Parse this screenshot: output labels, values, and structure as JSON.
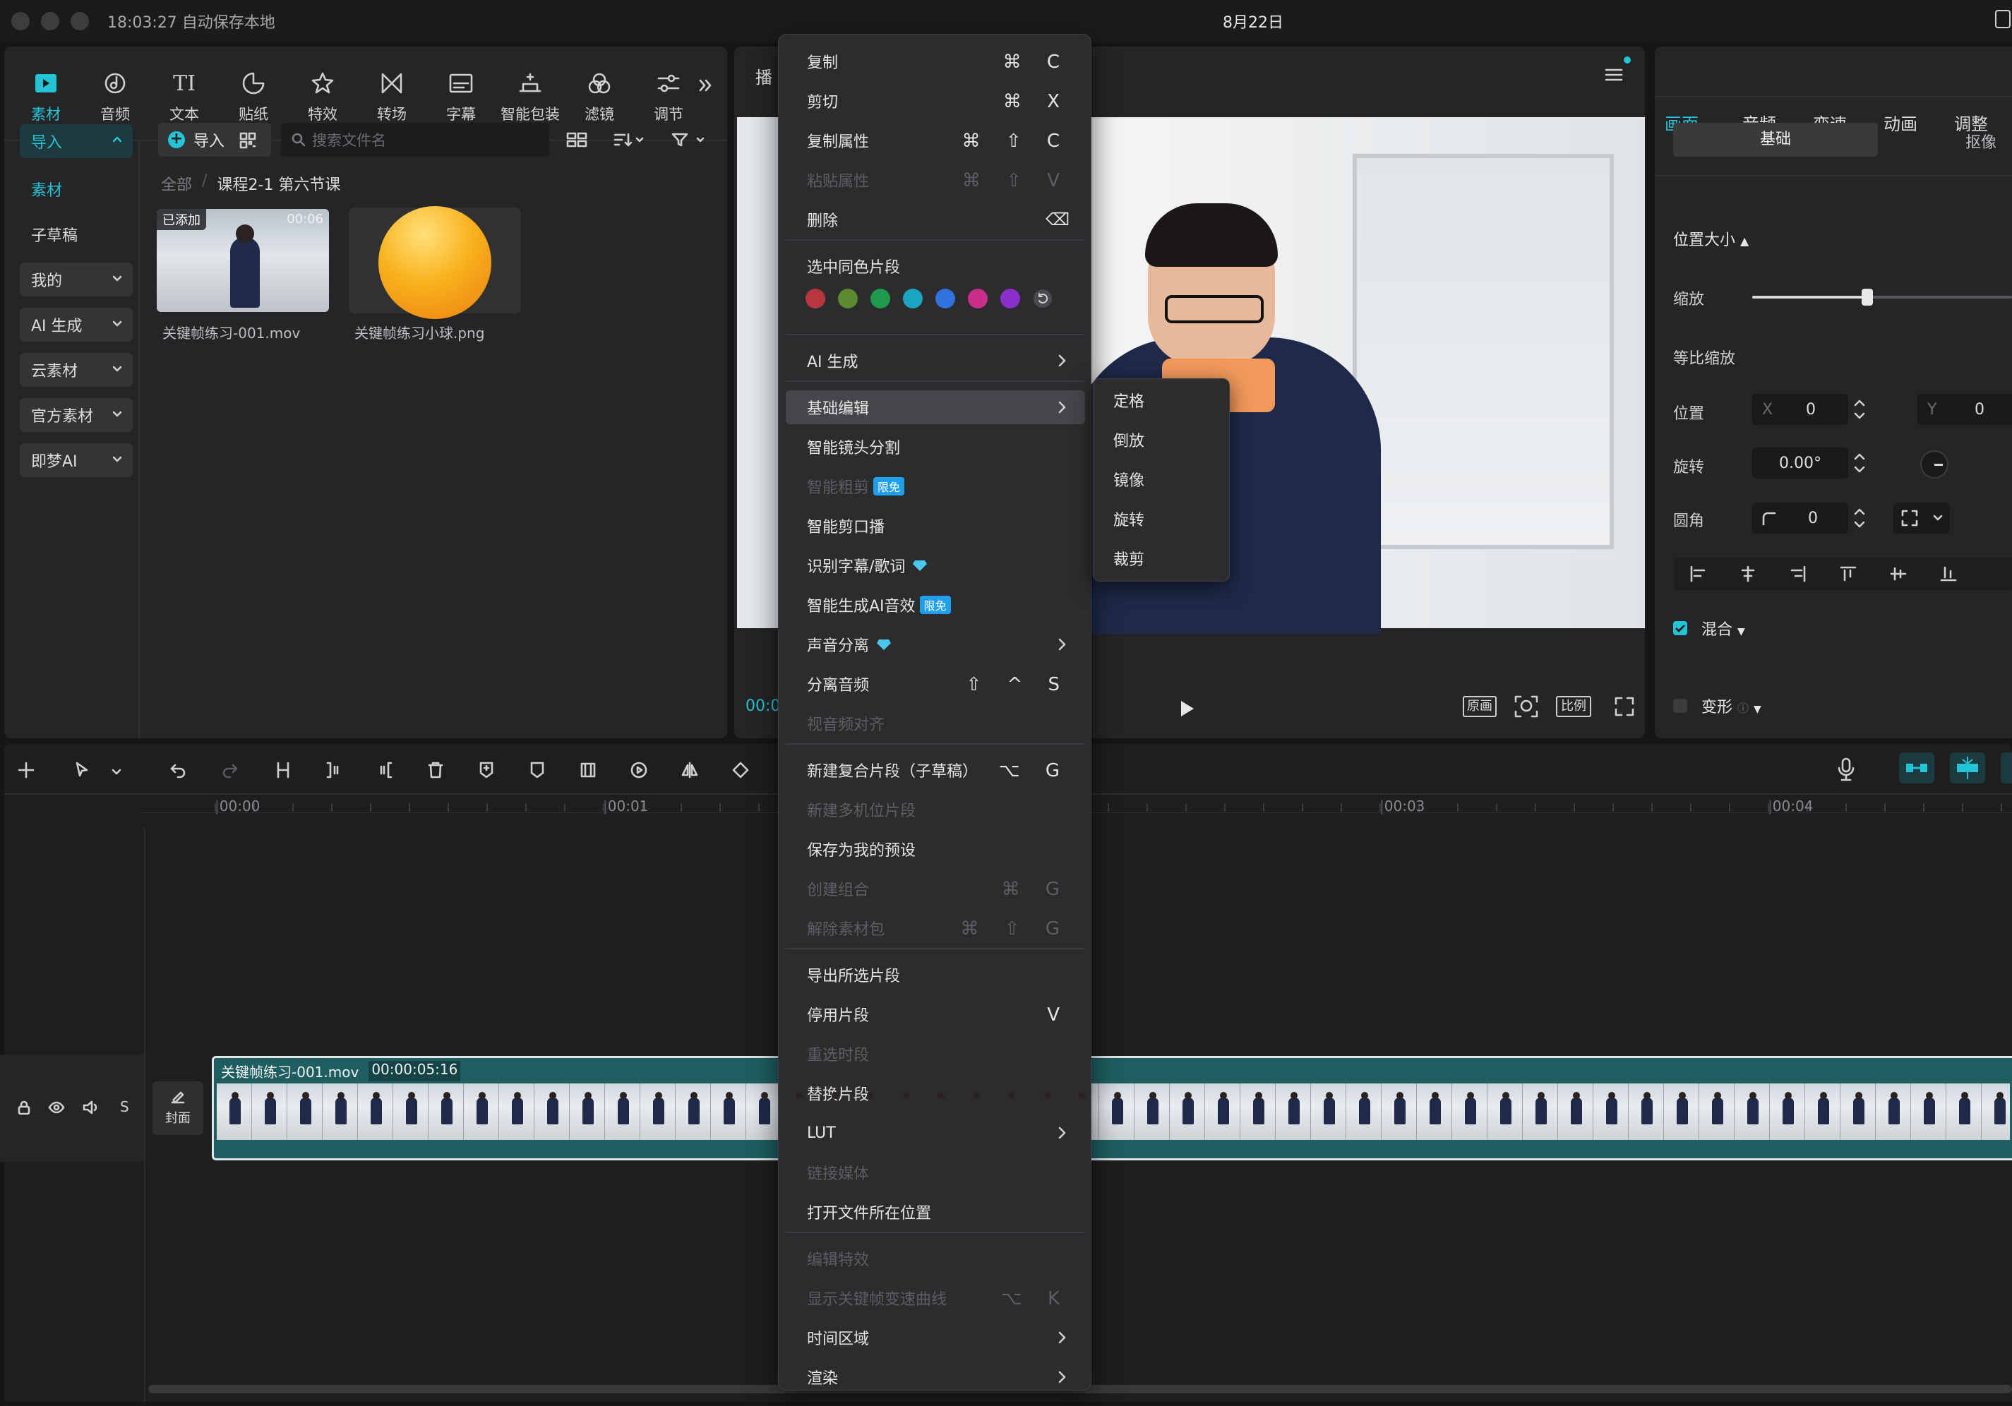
{
  "titlebar": {
    "autosave": "18:03:27 自动保存本地",
    "date": "8月22日"
  },
  "toolbar": {
    "tools": [
      {
        "label": "素材",
        "icon": "media-icon"
      },
      {
        "label": "音频",
        "icon": "audio-icon"
      },
      {
        "label": "文本",
        "icon": "text-icon",
        "glyph": "TI"
      },
      {
        "label": "贴纸",
        "icon": "sticker-icon"
      },
      {
        "label": "特效",
        "icon": "effects-icon"
      },
      {
        "label": "转场",
        "icon": "transition-icon"
      },
      {
        "label": "字幕",
        "icon": "subtitle-icon"
      },
      {
        "label": "智能包装",
        "icon": "smart-pack-icon"
      },
      {
        "label": "滤镜",
        "icon": "filter-icon"
      },
      {
        "label": "调节",
        "icon": "adjust-icon"
      }
    ]
  },
  "sidebar": {
    "items": [
      {
        "label": "导入",
        "state": "active"
      },
      {
        "label": "素材",
        "state": "selected"
      },
      {
        "label": "子草稿",
        "state": "plain"
      },
      {
        "label": "我的",
        "state": "expand"
      },
      {
        "label": "AI 生成",
        "state": "expand"
      },
      {
        "label": "云素材",
        "state": "expand"
      },
      {
        "label": "官方素材",
        "state": "expand"
      },
      {
        "label": "即梦AI",
        "state": "expand"
      }
    ]
  },
  "media": {
    "import_label": "导入",
    "search_placeholder": "搜索文件名",
    "breadcrumb_root": "全部",
    "breadcrumb_sep": "/",
    "breadcrumb_current": "课程2-1 第六节课",
    "files": [
      {
        "name": "关键帧练习-001.mov",
        "added_badge": "已添加",
        "duration": "00:06"
      },
      {
        "name": "关键帧练习小球.png"
      }
    ]
  },
  "player": {
    "title_partial": "播",
    "time_partial": "00:0",
    "btn_original": "原画",
    "btn_ratio": "比例"
  },
  "context_menu": {
    "items": [
      {
        "label": "复制",
        "shortcut": "⌘ C"
      },
      {
        "label": "剪切",
        "shortcut": "⌘ X"
      },
      {
        "label": "复制属性",
        "shortcut": "⌘ ⇧ C"
      },
      {
        "label": "粘贴属性",
        "shortcut": "⌘ ⇧ V",
        "disabled": true
      },
      {
        "label": "删除",
        "shortcut": "⌫"
      },
      {
        "label": "选中同色片段"
      },
      {
        "label": "AI 生成",
        "submenu": true
      },
      {
        "label": "基础编辑",
        "submenu": true,
        "highlighted": true
      },
      {
        "label": "智能镜头分割"
      },
      {
        "label": "智能粗剪",
        "badge": "限免",
        "disabled": true
      },
      {
        "label": "智能剪口播"
      },
      {
        "label": "识别字幕/歌词",
        "gem": true
      },
      {
        "label": "智能生成AI音效",
        "badge": "限免"
      },
      {
        "label": "声音分离",
        "gem": true,
        "submenu": true
      },
      {
        "label": "分离音频",
        "shortcut": "⇧ ^ S"
      },
      {
        "label": "视音频对齐",
        "disabled": true
      },
      {
        "label": "新建复合片段（子草稿）",
        "shortcut": "⌥ G"
      },
      {
        "label": "新建多机位片段",
        "disabled": true
      },
      {
        "label": "保存为我的预设"
      },
      {
        "label": "创建组合",
        "shortcut": "⌘ G",
        "disabled": true
      },
      {
        "label": "解除素材包",
        "shortcut": "⌘ ⇧ G",
        "disabled": true
      },
      {
        "label": "导出所选片段"
      },
      {
        "label": "停用片段",
        "shortcut": "V"
      },
      {
        "label": "重选时段",
        "disabled": true
      },
      {
        "label": "替换片段"
      },
      {
        "label": "LUT",
        "submenu": true
      },
      {
        "label": "链接媒体",
        "disabled": true
      },
      {
        "label": "打开文件所在位置"
      },
      {
        "label": "编辑特效",
        "disabled": true
      },
      {
        "label": "显示关键帧变速曲线",
        "shortcut": "⌥ K",
        "disabled": true
      },
      {
        "label": "时间区域",
        "submenu": true
      },
      {
        "label": "渲染",
        "submenu": true
      }
    ],
    "colors": [
      "#b8373f",
      "#5c8a2e",
      "#1e9a4c",
      "#1aa6c2",
      "#2f72e0",
      "#c92f8a",
      "#8a2fc9"
    ]
  },
  "submenu": {
    "items": [
      "定格",
      "倒放",
      "镜像",
      "旋转",
      "裁剪"
    ]
  },
  "inspector": {
    "tabs": [
      "画面",
      "音频",
      "变速",
      "动画",
      "调整"
    ],
    "subtabs": [
      "基础",
      "抠像"
    ],
    "section_title": "位置大小",
    "scale_label": "缩放",
    "scale_value": 0.6,
    "uniform_label": "等比缩放",
    "position_label": "位置",
    "x_label": "X",
    "x_value": "0",
    "y_label": "Y",
    "y_value": "0",
    "rotate_label": "旋转",
    "rotate_value": "0.00°",
    "corner_label": "圆角",
    "corner_value": "0",
    "blend_label": "混合",
    "transform_label": "变形"
  },
  "timeline": {
    "ruler": [
      "00:00",
      "00:01",
      "00:03",
      "00:04"
    ],
    "clip_name": "关键帧练习-001.mov",
    "clip_duration": "00:00:05:16",
    "cover_label": "封面",
    "track_s": "S"
  },
  "colors": {
    "accent": "#22c4d6",
    "clip": "#1e5e60",
    "bg": "#161616",
    "panel": "#252527"
  }
}
